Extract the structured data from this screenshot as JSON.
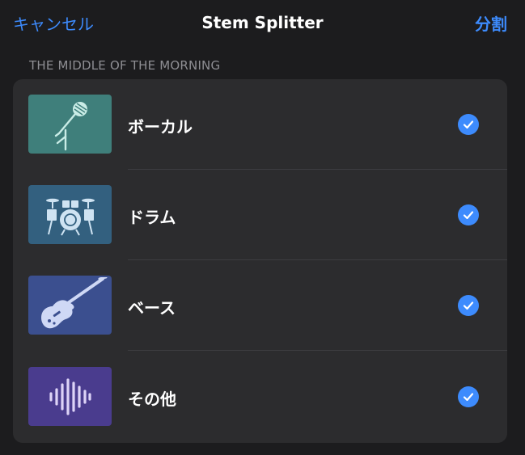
{
  "nav": {
    "cancel_label": "キャンセル",
    "title": "Stem Splitter",
    "split_label": "分割"
  },
  "section": {
    "header": "THE MIDDLE OF THE MORNING"
  },
  "stems": [
    {
      "label": "ボーカル",
      "icon": "microphone-icon",
      "color": "#3f7f7b",
      "checked": true
    },
    {
      "label": "ドラム",
      "icon": "drum-kit-icon",
      "color": "#33607f",
      "checked": true
    },
    {
      "label": "ベース",
      "icon": "bass-guitar-icon",
      "color": "#3b4f8f",
      "checked": true
    },
    {
      "label": "その他",
      "icon": "waveform-icon",
      "color": "#4a3c8e",
      "checked": true
    }
  ],
  "colors": {
    "accent": "#3d8bfd",
    "background": "#1c1c1e",
    "card": "#2c2c2e"
  }
}
